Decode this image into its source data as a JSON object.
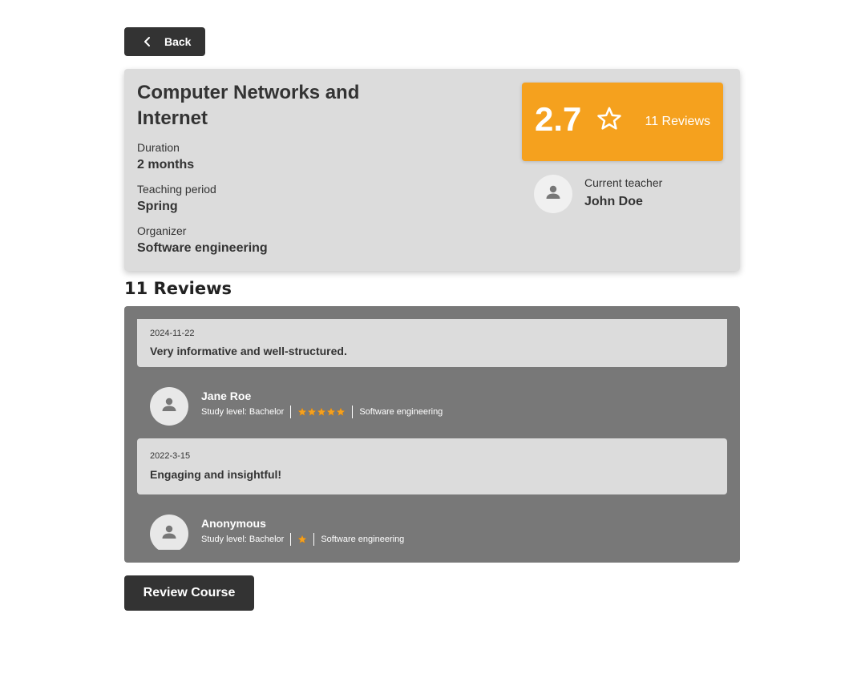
{
  "nav": {
    "back_label": "Back"
  },
  "course": {
    "title": "Computer Networks and Internet",
    "duration_label": "Duration",
    "duration_value": "2 months",
    "period_label": "Teaching period",
    "period_value": "Spring",
    "organizer_label": "Organizer",
    "organizer_value": "Software engineering"
  },
  "rating": {
    "value": "2.7",
    "reviews_count_label": "11 Reviews",
    "star_icon": "star-outline-icon"
  },
  "teacher": {
    "label": "Current teacher",
    "name": "John Doe",
    "avatar_icon": "person-icon"
  },
  "reviews_heading": "11 Reviews",
  "reviews": [
    {
      "date": "2024-11-22",
      "text": "Very informative and well-structured.",
      "reviewer": "Jane Roe",
      "study_level": "Study level: Bachelor",
      "stars": 5,
      "program": "Software engineering"
    },
    {
      "date": "2022-3-15",
      "text": "Engaging and insightful!",
      "reviewer": "Anonymous",
      "study_level": "Study level: Bachelor",
      "stars": 1,
      "program": "Software engineering"
    }
  ],
  "actions": {
    "review_course_label": "Review Course"
  },
  "colors": {
    "accent": "#f5a11e",
    "dark": "#333333",
    "card_bg": "#dcdcdc",
    "panel_bg": "#787878",
    "star_fill": "#f5a11e"
  }
}
